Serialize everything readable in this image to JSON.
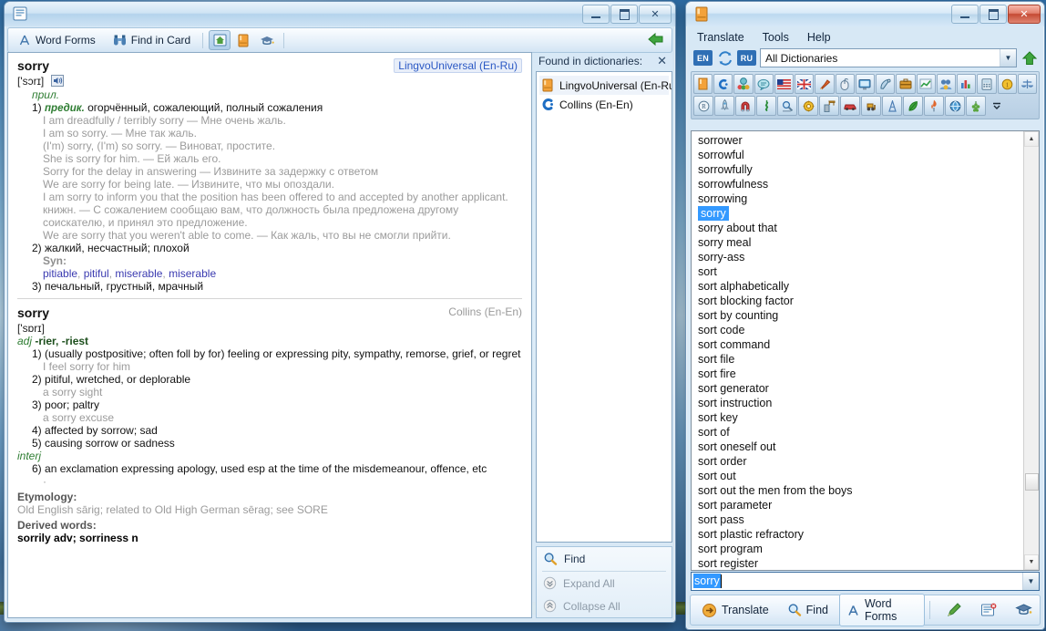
{
  "desktop": {
    "label": "desktop-background"
  },
  "left_window": {
    "title": "",
    "icon": "card-icon",
    "window_buttons": {
      "minimize": "Minimize",
      "maximize": "Maximize",
      "close": "Close"
    },
    "toolbar": {
      "word_forms": "Word Forms",
      "find_in_card": "Find in Card",
      "icons": [
        "home-card-icon",
        "orange-book-icon",
        "graduation-cap-icon"
      ],
      "back": "back-arrow-icon"
    },
    "entries": [
      {
        "headword": "sorry",
        "dictionary": "LingvoUniversal (En-Ru)",
        "dictionary_is_link": true,
        "transcription": "['sɔrɪ]",
        "has_sound": true,
        "pos": "прил.",
        "senses": [
          {
            "num": "1)",
            "mark": "предик.",
            "text": "огорчённый, сожалеющий, полный сожаления",
            "examples": [
              "I am dreadfully / terribly sorry — Мне очень жаль.",
              "I am so sorry. — Мне так жаль.",
              "(I'm) sorry, (I'm) so sorry. — Виноват, простите.",
              "She is sorry for him. — Ей жаль его.",
              "Sorry for the delay in answering — Извините за задержку с ответом",
              "We are sorry for being late. — Извините, что мы опоздали.",
              "I am sorry to inform you that the position has been offered to and accepted by another applicant. книжн. — С сожалением сообщаю вам, что должность была предложена другому соискателю, и принял это предложение.",
              "We are sorry that you weren't able to come. — Как жаль, что вы не смогли прийти."
            ]
          },
          {
            "num": "2)",
            "mark": "",
            "text": "жалкий, несчастный; плохой",
            "syn_label": "Syn:",
            "synonyms": [
              "pitiable",
              "pitiful",
              "miserable",
              "miserable"
            ],
            "examples": []
          },
          {
            "num": "3)",
            "mark": "",
            "text": "печальный, грустный, мрачный",
            "examples": []
          }
        ]
      },
      {
        "headword": "sorry",
        "dictionary": "Collins (En-En)",
        "dictionary_is_link": false,
        "transcription": "['sɒrɪ]",
        "has_sound": false,
        "pos": "adj",
        "pos_extra": "-rier, -riest",
        "senses": [
          {
            "num": "1)",
            "text": "(usually postpositive; often foll by for) feeling or expressing pity, sympathy, remorse, grief, or regret",
            "examples": [
              "I feel sorry for him"
            ]
          },
          {
            "num": "2)",
            "text": "pitiful, wretched, or deplorable",
            "examples": [
              "a sorry sight"
            ]
          },
          {
            "num": "3)",
            "text": "poor; paltry",
            "examples": [
              "a sorry excuse"
            ]
          },
          {
            "num": "4)",
            "text": "affected by sorrow; sad",
            "examples": []
          },
          {
            "num": "5)",
            "text": "causing sorrow or sadness",
            "examples": []
          }
        ],
        "pos2": "interj",
        "senses2": [
          {
            "num": "6)",
            "text": "an exclamation expressing apology, used esp at the time of the misdemeanour, offence, etc",
            "examples": [
              "·"
            ]
          }
        ],
        "etymology_label": "Etymology:",
        "etymology": "Old English sārig;  related to Old High German sērag;  see SORE",
        "derived_label": "Derived words:",
        "derived": "sorrily adv; sorriness n"
      }
    ],
    "found_panel": {
      "title": "Found in dictionaries:",
      "close": "✕",
      "items": [
        {
          "label": "LingvoUniversal (En-Ru)",
          "icon": "orange-book-icon",
          "selected": true
        },
        {
          "label": "Collins (En-En)",
          "icon": "collins-c-icon",
          "selected": false
        }
      ],
      "actions": [
        {
          "label": "Find",
          "icon": "magnifier-icon",
          "dim": false
        },
        {
          "label": "Expand All",
          "icon": "chevron-double-down-icon",
          "dim": true
        },
        {
          "label": "Collapse All",
          "icon": "chevron-double-up-icon",
          "dim": true
        }
      ]
    }
  },
  "right_window": {
    "title": "",
    "icon": "orange-book-icon",
    "window_buttons": {
      "minimize": "Minimize",
      "maximize": "Maximize",
      "close": "Close"
    },
    "menu": [
      "Translate",
      "Tools",
      "Help"
    ],
    "search": {
      "lang_from": "EN",
      "lang_to": "RU",
      "swap_icon": "swap-languages-icon",
      "dictionary_value": "All Dictionaries",
      "dictionary_placeholder": "All Dictionaries",
      "dropdown_icon": "chevron-down-icon",
      "up_icon": "green-up-arrow-icon"
    },
    "dictionary_icons_row1": [
      "orange-book-icon",
      "collins-c-icon",
      "three-people-speech-icon",
      "speech-bubble-icon",
      "us-flag-icon",
      "uk-flag-icon",
      "paintbrush-icon",
      "computer-mouse-icon",
      "monitor-icon",
      "satellite-dish-icon",
      "briefcase-icon",
      "chart-line-icon",
      "two-people-icon",
      "bar-chart-icon",
      "calculator-icon",
      "gold-coin-icon",
      "scales-icon"
    ],
    "dictionary_icons_row2": [
      "registered-mark-icon",
      "rocket-icon",
      "magnet-icon",
      "caduceus-icon",
      "microscope-icon",
      "gear-icon",
      "crane-icon",
      "red-car-icon",
      "bulldozer-icon",
      "oil-derrick-icon",
      "leaf-icon",
      "fire-torch-icon",
      "globe-icon",
      "grapes-icon",
      "overflow-chevron-icon"
    ],
    "word_list": [
      {
        "label": "sorrower",
        "selected": false
      },
      {
        "label": "sorrowful",
        "selected": false
      },
      {
        "label": "sorrowfully",
        "selected": false
      },
      {
        "label": "sorrowfulness",
        "selected": false
      },
      {
        "label": "sorrowing",
        "selected": false
      },
      {
        "label": "sorry",
        "selected": true
      },
      {
        "label": "sorry about that",
        "selected": false
      },
      {
        "label": "sorry meal",
        "selected": false
      },
      {
        "label": "sorry-ass",
        "selected": false
      },
      {
        "label": "sort",
        "selected": false
      },
      {
        "label": "sort alphabetically",
        "selected": false
      },
      {
        "label": "sort blocking factor",
        "selected": false
      },
      {
        "label": "sort by counting",
        "selected": false
      },
      {
        "label": "sort code",
        "selected": false
      },
      {
        "label": "sort command",
        "selected": false
      },
      {
        "label": "sort file",
        "selected": false
      },
      {
        "label": "sort fire",
        "selected": false
      },
      {
        "label": "sort generator",
        "selected": false
      },
      {
        "label": "sort instruction",
        "selected": false
      },
      {
        "label": "sort key",
        "selected": false
      },
      {
        "label": "sort of",
        "selected": false
      },
      {
        "label": "sort oneself out",
        "selected": false
      },
      {
        "label": "sort order",
        "selected": false
      },
      {
        "label": "sort out",
        "selected": false
      },
      {
        "label": "sort out the men from the boys",
        "selected": false
      },
      {
        "label": "sort parameter",
        "selected": false
      },
      {
        "label": "sort pass",
        "selected": false
      },
      {
        "label": "sort plastic refractory",
        "selected": false
      },
      {
        "label": "sort program",
        "selected": false
      },
      {
        "label": "sort register",
        "selected": false
      }
    ],
    "search_field": {
      "value": "sorry",
      "placeholder": "sorry"
    },
    "bottom_bar": {
      "translate": "Translate",
      "find": "Find",
      "word_forms": "Word Forms",
      "icons": [
        "green-pencil-icon",
        "card-delete-icon",
        "graduation-cap-icon"
      ]
    }
  },
  "colors": {
    "accent_blue": "#3399ff",
    "link_blue": "#2a58c4",
    "green_label": "#2e7d32",
    "example_grey": "#9b9b9b",
    "title_grey": "#9a9a9a"
  }
}
